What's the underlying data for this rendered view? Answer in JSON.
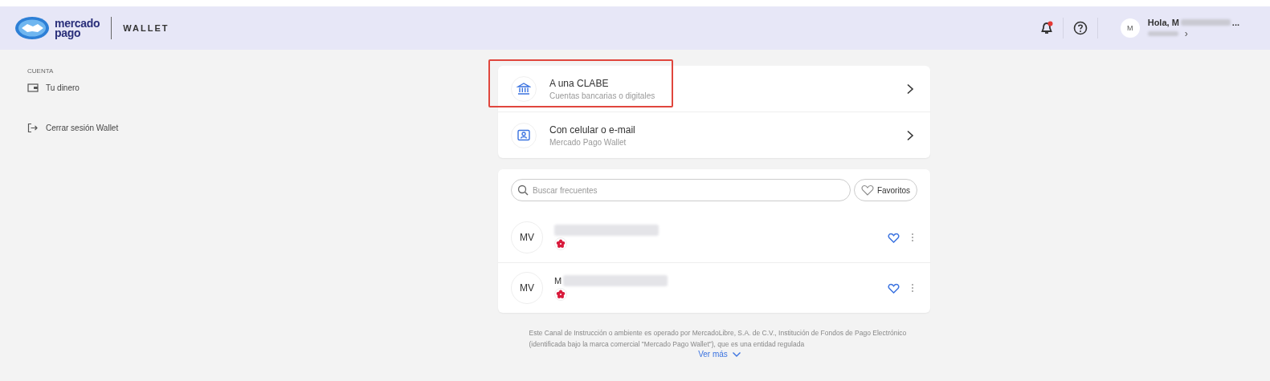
{
  "header": {
    "brand": [
      "mercado",
      "pago"
    ],
    "product": "WALLET",
    "notification_dot": true,
    "avatar": "M",
    "greeting": "Hola, M",
    "greeting_tail": "...",
    "account_chevron": "›"
  },
  "sidebar": {
    "section": "CUENTA",
    "items": [
      {
        "kind": "wallet",
        "label": "Tu dinero"
      },
      {
        "kind": "logout",
        "label": "Cerrar sesión Wallet"
      }
    ]
  },
  "transfer_options": [
    {
      "kind": "bank",
      "title": "A una CLABE",
      "subtitle": "Cuentas bancarias o digitales",
      "highlighted": true
    },
    {
      "kind": "contact",
      "title": "Con celular o e-mail",
      "subtitle": "Mercado Pago Wallet",
      "highlighted": false
    }
  ],
  "frequent": {
    "search": {
      "placeholder": "Buscar frecuentes"
    },
    "favorites_button": "Favoritos",
    "contacts": [
      {
        "initials": "MV",
        "name_redacted": true
      },
      {
        "initials": "MV",
        "name": "M",
        "name_redacted": true
      }
    ]
  },
  "footer": {
    "legal": "Este Canal de Instrucción o ambiente es operado por MercadoLibre, S.A. de C.V., Institución de Fondos de Pago Electrónico (identificada bajo la marca comercial \"Mercado Pago Wallet\"), que es una entidad regulada",
    "more_link": "Ver más"
  }
}
